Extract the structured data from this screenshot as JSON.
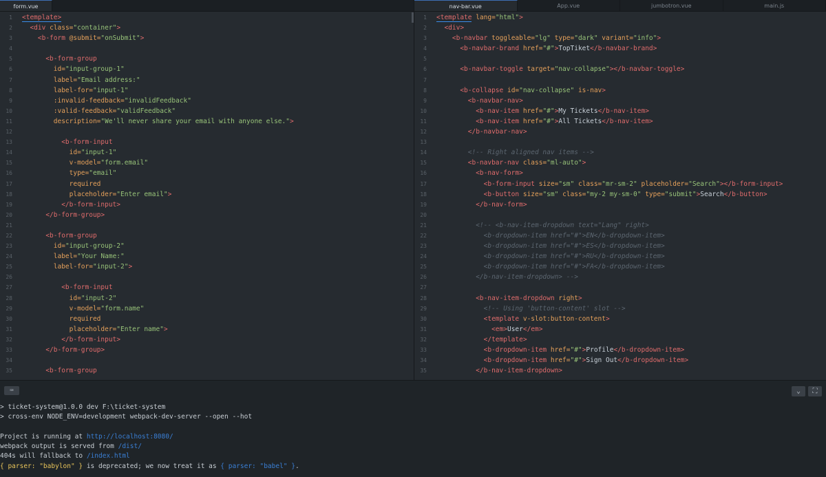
{
  "left_pane": {
    "tab": "form.vue",
    "lines": [
      [
        [
          "t-tag",
          "<template>"
        ]
      ],
      [
        [
          "t-punct",
          "  "
        ],
        [
          "t-tag",
          "<div"
        ],
        [
          "t-attr",
          " class="
        ],
        [
          "t-str",
          "\"container\""
        ],
        [
          "t-tag",
          ">"
        ]
      ],
      [
        [
          "t-punct",
          "    "
        ],
        [
          "t-tag",
          "<b-form"
        ],
        [
          "t-attr",
          " @submit="
        ],
        [
          "t-str",
          "\"onSubmit\""
        ],
        [
          "t-tag",
          ">"
        ]
      ],
      [],
      [
        [
          "t-punct",
          "      "
        ],
        [
          "t-tag",
          "<b-form-group"
        ]
      ],
      [
        [
          "t-punct",
          "        "
        ],
        [
          "t-attr",
          "id="
        ],
        [
          "t-str",
          "\"input-group-1\""
        ]
      ],
      [
        [
          "t-punct",
          "        "
        ],
        [
          "t-attr",
          "label="
        ],
        [
          "t-str",
          "\"Email address:\""
        ]
      ],
      [
        [
          "t-punct",
          "        "
        ],
        [
          "t-attr",
          "label-for="
        ],
        [
          "t-str",
          "\"input-1\""
        ]
      ],
      [
        [
          "t-punct",
          "        "
        ],
        [
          "t-attr",
          ":invalid-feedback="
        ],
        [
          "t-str",
          "\"invalidFeedback\""
        ]
      ],
      [
        [
          "t-punct",
          "        "
        ],
        [
          "t-attr",
          ":valid-feedback="
        ],
        [
          "t-str",
          "\"validFeedback\""
        ]
      ],
      [
        [
          "t-punct",
          "        "
        ],
        [
          "t-attr",
          "description="
        ],
        [
          "t-str",
          "\"We'll never share your email with anyone else.\""
        ],
        [
          "t-tag",
          ">"
        ]
      ],
      [],
      [
        [
          "t-punct",
          "          "
        ],
        [
          "t-tag",
          "<b-form-input"
        ]
      ],
      [
        [
          "t-punct",
          "            "
        ],
        [
          "t-attr",
          "id="
        ],
        [
          "t-str",
          "\"input-1\""
        ]
      ],
      [
        [
          "t-punct",
          "            "
        ],
        [
          "t-attr",
          "v-model="
        ],
        [
          "t-str",
          "\"form.email\""
        ]
      ],
      [
        [
          "t-punct",
          "            "
        ],
        [
          "t-attr",
          "type="
        ],
        [
          "t-str",
          "\"email\""
        ]
      ],
      [
        [
          "t-punct",
          "            "
        ],
        [
          "t-attr",
          "required"
        ]
      ],
      [
        [
          "t-punct",
          "            "
        ],
        [
          "t-attr",
          "placeholder="
        ],
        [
          "t-str",
          "\"Enter email\""
        ],
        [
          "t-tag",
          ">"
        ]
      ],
      [
        [
          "t-punct",
          "          "
        ],
        [
          "t-tag",
          "</b-form-input>"
        ]
      ],
      [
        [
          "t-punct",
          "      "
        ],
        [
          "t-tag",
          "</b-form-group>"
        ]
      ],
      [],
      [
        [
          "t-punct",
          "      "
        ],
        [
          "t-tag",
          "<b-form-group"
        ]
      ],
      [
        [
          "t-punct",
          "        "
        ],
        [
          "t-attr",
          "id="
        ],
        [
          "t-str",
          "\"input-group-2\""
        ]
      ],
      [
        [
          "t-punct",
          "        "
        ],
        [
          "t-attr",
          "label="
        ],
        [
          "t-str",
          "\"Your Name:\""
        ]
      ],
      [
        [
          "t-punct",
          "        "
        ],
        [
          "t-attr",
          "label-for="
        ],
        [
          "t-str",
          "\"input-2\""
        ],
        [
          "t-tag",
          ">"
        ]
      ],
      [],
      [
        [
          "t-punct",
          "          "
        ],
        [
          "t-tag",
          "<b-form-input"
        ]
      ],
      [
        [
          "t-punct",
          "            "
        ],
        [
          "t-attr",
          "id="
        ],
        [
          "t-str",
          "\"input-2\""
        ]
      ],
      [
        [
          "t-punct",
          "            "
        ],
        [
          "t-attr",
          "v-model="
        ],
        [
          "t-str",
          "\"form.name\""
        ]
      ],
      [
        [
          "t-punct",
          "            "
        ],
        [
          "t-attr",
          "required"
        ]
      ],
      [
        [
          "t-punct",
          "            "
        ],
        [
          "t-attr",
          "placeholder="
        ],
        [
          "t-str",
          "\"Enter name\""
        ],
        [
          "t-tag",
          ">"
        ]
      ],
      [
        [
          "t-punct",
          "          "
        ],
        [
          "t-tag",
          "</b-form-input>"
        ]
      ],
      [
        [
          "t-punct",
          "      "
        ],
        [
          "t-tag",
          "</b-form-group>"
        ]
      ],
      [],
      [
        [
          "t-punct",
          "      "
        ],
        [
          "t-tag",
          "<b-form-group"
        ]
      ]
    ]
  },
  "right_pane": {
    "tabs": [
      "nav-bar.vue",
      "App.vue",
      "jumbotron.vue",
      "main.js"
    ],
    "active_tab": 0,
    "lines": [
      [
        [
          "t-tag",
          "<template"
        ],
        [
          "t-attr",
          " lang="
        ],
        [
          "t-str",
          "\"html\""
        ],
        [
          "t-tag",
          ">"
        ]
      ],
      [
        [
          "t-punct",
          "  "
        ],
        [
          "t-tag",
          "<div>"
        ]
      ],
      [
        [
          "t-punct",
          "    "
        ],
        [
          "t-tag",
          "<b-navbar"
        ],
        [
          "t-attr",
          " toggleable="
        ],
        [
          "t-str",
          "\"lg\""
        ],
        [
          "t-attr",
          " type="
        ],
        [
          "t-str",
          "\"dark\""
        ],
        [
          "t-attr",
          " variant="
        ],
        [
          "t-str",
          "\"info\""
        ],
        [
          "t-tag",
          ">"
        ]
      ],
      [
        [
          "t-punct",
          "      "
        ],
        [
          "t-tag",
          "<b-navbar-brand"
        ],
        [
          "t-attr",
          " href="
        ],
        [
          "t-str",
          "\"#\""
        ],
        [
          "t-tag",
          ">"
        ],
        [
          "t-text",
          "TopTiket"
        ],
        [
          "t-tag",
          "</b-navbar-brand>"
        ]
      ],
      [],
      [
        [
          "t-punct",
          "      "
        ],
        [
          "t-tag",
          "<b-navbar-toggle"
        ],
        [
          "t-attr",
          " target="
        ],
        [
          "t-str",
          "\"nav-collapse\""
        ],
        [
          "t-tag",
          "></b-navbar-toggle>"
        ]
      ],
      [],
      [
        [
          "t-punct",
          "      "
        ],
        [
          "t-tag",
          "<b-collapse"
        ],
        [
          "t-attr",
          " id="
        ],
        [
          "t-str",
          "\"nav-collapse\""
        ],
        [
          "t-attr",
          " is-nav"
        ],
        [
          "t-tag",
          ">"
        ]
      ],
      [
        [
          "t-punct",
          "        "
        ],
        [
          "t-tag",
          "<b-navbar-nav>"
        ]
      ],
      [
        [
          "t-punct",
          "          "
        ],
        [
          "t-tag",
          "<b-nav-item"
        ],
        [
          "t-attr",
          " href="
        ],
        [
          "t-str",
          "\"#\""
        ],
        [
          "t-tag",
          ">"
        ],
        [
          "t-text",
          "My Tickets"
        ],
        [
          "t-tag",
          "</b-nav-item>"
        ]
      ],
      [
        [
          "t-punct",
          "          "
        ],
        [
          "t-tag",
          "<b-nav-item"
        ],
        [
          "t-attr",
          " href="
        ],
        [
          "t-str",
          "\"#\""
        ],
        [
          "t-tag",
          ">"
        ],
        [
          "t-text",
          "All Tickets"
        ],
        [
          "t-tag",
          "</b-nav-item>"
        ]
      ],
      [
        [
          "t-punct",
          "        "
        ],
        [
          "t-tag",
          "</b-navbar-nav>"
        ]
      ],
      [],
      [
        [
          "t-punct",
          "        "
        ],
        [
          "t-comment",
          "<!-- Right aligned nav items -->"
        ]
      ],
      [
        [
          "t-punct",
          "        "
        ],
        [
          "t-tag",
          "<b-navbar-nav"
        ],
        [
          "t-attr",
          " class="
        ],
        [
          "t-str",
          "\"ml-auto\""
        ],
        [
          "t-tag",
          ">"
        ]
      ],
      [
        [
          "t-punct",
          "          "
        ],
        [
          "t-tag",
          "<b-nav-form>"
        ]
      ],
      [
        [
          "t-punct",
          "            "
        ],
        [
          "t-tag",
          "<b-form-input"
        ],
        [
          "t-attr",
          " size="
        ],
        [
          "t-str",
          "\"sm\""
        ],
        [
          "t-attr",
          " class="
        ],
        [
          "t-str",
          "\"mr-sm-2\""
        ],
        [
          "t-attr",
          " placeholder="
        ],
        [
          "t-str",
          "\"Search\""
        ],
        [
          "t-tag",
          "></b-form-input>"
        ]
      ],
      [
        [
          "t-punct",
          "            "
        ],
        [
          "t-tag",
          "<b-button"
        ],
        [
          "t-attr",
          " size="
        ],
        [
          "t-str",
          "\"sm\""
        ],
        [
          "t-attr",
          " class="
        ],
        [
          "t-str",
          "\"my-2 my-sm-0\""
        ],
        [
          "t-attr",
          " type="
        ],
        [
          "t-str",
          "\"submit\""
        ],
        [
          "t-tag",
          ">"
        ],
        [
          "t-text",
          "Search"
        ],
        [
          "t-tag",
          "</b-button>"
        ]
      ],
      [
        [
          "t-punct",
          "          "
        ],
        [
          "t-tag",
          "</b-nav-form>"
        ]
      ],
      [],
      [
        [
          "t-punct",
          "          "
        ],
        [
          "t-comment",
          "<!-- <b-nav-item-dropdown text=\"Lang\" right>"
        ]
      ],
      [
        [
          "t-punct",
          "            "
        ],
        [
          "t-comment",
          "<b-dropdown-item href=\"#\">EN</b-dropdown-item>"
        ]
      ],
      [
        [
          "t-punct",
          "            "
        ],
        [
          "t-comment",
          "<b-dropdown-item href=\"#\">ES</b-dropdown-item>"
        ]
      ],
      [
        [
          "t-punct",
          "            "
        ],
        [
          "t-comment",
          "<b-dropdown-item href=\"#\">RU</b-dropdown-item>"
        ]
      ],
      [
        [
          "t-punct",
          "            "
        ],
        [
          "t-comment",
          "<b-dropdown-item href=\"#\">FA</b-dropdown-item>"
        ]
      ],
      [
        [
          "t-punct",
          "          "
        ],
        [
          "t-comment",
          "</b-nav-item-dropdown> -->"
        ]
      ],
      [],
      [
        [
          "t-punct",
          "          "
        ],
        [
          "t-tag",
          "<b-nav-item-dropdown"
        ],
        [
          "t-attr",
          " right"
        ],
        [
          "t-tag",
          ">"
        ]
      ],
      [
        [
          "t-punct",
          "            "
        ],
        [
          "t-comment",
          "<!-- Using 'button-content' slot -->"
        ]
      ],
      [
        [
          "t-punct",
          "            "
        ],
        [
          "t-tag",
          "<template"
        ],
        [
          "t-attr",
          " v-slot:button-content"
        ],
        [
          "t-tag",
          ">"
        ]
      ],
      [
        [
          "t-punct",
          "              "
        ],
        [
          "t-tag",
          "<em>"
        ],
        [
          "t-text",
          "User"
        ],
        [
          "t-tag",
          "</em>"
        ]
      ],
      [
        [
          "t-punct",
          "            "
        ],
        [
          "t-tag",
          "</template>"
        ]
      ],
      [
        [
          "t-punct",
          "            "
        ],
        [
          "t-tag",
          "<b-dropdown-item"
        ],
        [
          "t-attr",
          " href="
        ],
        [
          "t-str",
          "\"#\""
        ],
        [
          "t-tag",
          ">"
        ],
        [
          "t-text",
          "Profile"
        ],
        [
          "t-tag",
          "</b-dropdown-item>"
        ]
      ],
      [
        [
          "t-punct",
          "            "
        ],
        [
          "t-tag",
          "<b-dropdown-item"
        ],
        [
          "t-attr",
          " href="
        ],
        [
          "t-str",
          "\"#\""
        ],
        [
          "t-tag",
          ">"
        ],
        [
          "t-text",
          "Sign Out"
        ],
        [
          "t-tag",
          "</b-dropdown-item>"
        ]
      ],
      [
        [
          "t-punct",
          "          "
        ],
        [
          "t-tag",
          "</b-nav-item-dropdown>"
        ]
      ]
    ]
  },
  "terminal": {
    "lines": [
      [
        [
          "",
          "> ticket-system@1.0.0 dev F:\\ticket-system"
        ]
      ],
      [
        [
          "",
          "> cross-env NODE_ENV=development webpack-dev-server --open --hot"
        ]
      ],
      [
        [
          "",
          ""
        ]
      ],
      [
        [
          "",
          "Project is running at "
        ],
        [
          "link",
          "http://localhost:8080/"
        ]
      ],
      [
        [
          "",
          "webpack output is served from "
        ],
        [
          "link",
          "/dist/"
        ]
      ],
      [
        [
          "",
          "404s will fallback to "
        ],
        [
          "link",
          "/index.html"
        ]
      ],
      [
        [
          "warn",
          "{ parser: \"babylon\" }"
        ],
        [
          "",
          " is deprecated; we now treat it as "
        ],
        [
          "quote",
          "{ parser: \"babel\" }"
        ],
        [
          "",
          "."
        ]
      ]
    ],
    "icons": {
      "keyboard": "⌨",
      "chevron": "⌄",
      "maximize": "⛶"
    }
  }
}
